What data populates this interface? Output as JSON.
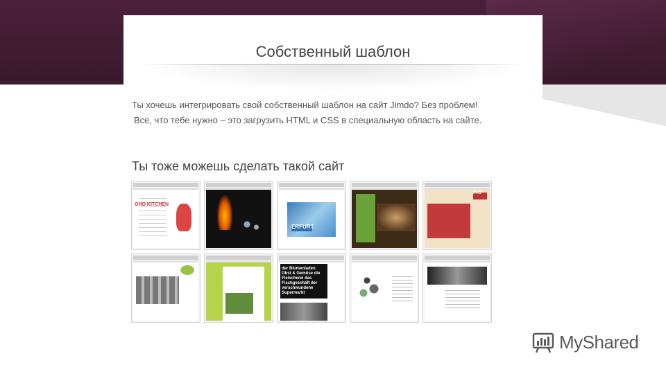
{
  "slide": {
    "title": "Собственный шаблон",
    "intro_line1": "Ты хочешь интегрировать свой собственный шаблон на сайт Jimdo? Без проблем!",
    "intro_line2": "Все, что тебе нужно – это загрузить HTML и CSS в специальную область на сайте.",
    "subtitle": "Ты тоже можешь сделать такой сайт",
    "thumbnails": [
      {
        "text": "OHO KITCHEN"
      },
      {
        "text": ""
      },
      {
        "text": "ERFURT"
      },
      {
        "text": ""
      },
      {
        "text": "PAS"
      },
      {
        "text": ""
      },
      {
        "text": ""
      },
      {
        "text": "der Blumenladen Obst & Gemüse die Fleischerei das Fischgeschäft der verschwundene Supermarkt"
      },
      {
        "text": ""
      },
      {
        "text": ""
      }
    ]
  },
  "watermark": {
    "label": "MyShared",
    "icon": "myshared-logo-icon"
  },
  "colors": {
    "band": "#3a1a2c",
    "title": "#444444",
    "text": "#555555"
  }
}
